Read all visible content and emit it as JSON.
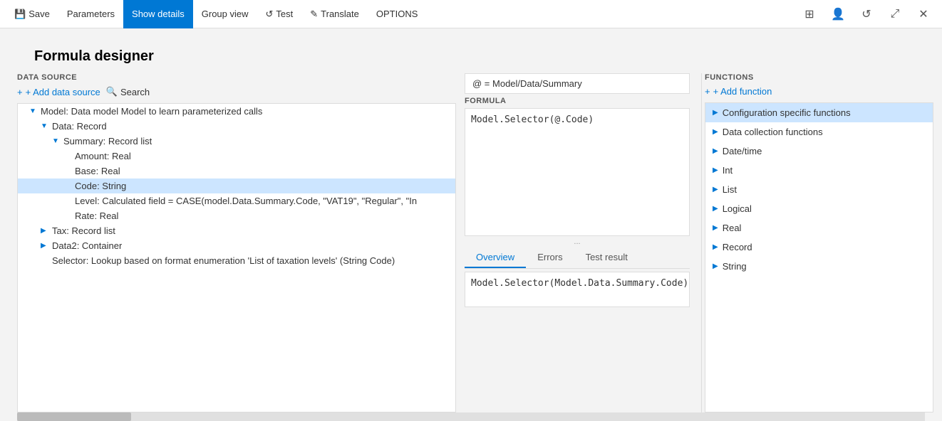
{
  "titlebar": {
    "save_label": "Save",
    "parameters_label": "Parameters",
    "show_details_label": "Show details",
    "group_view_label": "Group view",
    "test_label": "Test",
    "translate_label": "Translate",
    "options_label": "OPTIONS"
  },
  "page": {
    "title": "Formula designer"
  },
  "datasource": {
    "label": "DATA SOURCE",
    "add_label": "+ Add data source",
    "search_label": "Search",
    "tree": [
      {
        "level": 1,
        "indent": "indent-1",
        "has_arrow": true,
        "arrow": "▼",
        "text": "Model: Data model Model to learn parameterized calls",
        "selected": false
      },
      {
        "level": 2,
        "indent": "indent-2",
        "has_arrow": true,
        "arrow": "▼",
        "text": "Data: Record",
        "selected": false
      },
      {
        "level": 3,
        "indent": "indent-3",
        "has_arrow": true,
        "arrow": "▼",
        "text": "Summary: Record list",
        "selected": false
      },
      {
        "level": 4,
        "indent": "indent-4",
        "has_arrow": false,
        "arrow": "",
        "text": "Amount: Real",
        "selected": false
      },
      {
        "level": 4,
        "indent": "indent-4",
        "has_arrow": false,
        "arrow": "",
        "text": "Base: Real",
        "selected": false
      },
      {
        "level": 4,
        "indent": "indent-4",
        "has_arrow": false,
        "arrow": "",
        "text": "Code: String",
        "selected": true
      },
      {
        "level": 4,
        "indent": "indent-4",
        "has_arrow": false,
        "arrow": "",
        "text": "Level: Calculated field = CASE(model.Data.Summary.Code, \"VAT19\", \"Regular\", \"In",
        "selected": false
      },
      {
        "level": 4,
        "indent": "indent-4",
        "has_arrow": false,
        "arrow": "",
        "text": "Rate: Real",
        "selected": false
      },
      {
        "level": 2,
        "indent": "indent-2",
        "has_arrow": true,
        "arrow": "▶",
        "text": "Tax: Record list",
        "selected": false
      },
      {
        "level": 2,
        "indent": "indent-2",
        "has_arrow": true,
        "arrow": "▶",
        "text": "Data2: Container",
        "selected": false
      },
      {
        "level": 2,
        "indent": "indent-2",
        "has_arrow": false,
        "arrow": "",
        "text": "Selector: Lookup based on format enumeration 'List of taxation levels' (String Code)",
        "selected": false
      }
    ]
  },
  "formula": {
    "path": "@ = Model/Data/Summary",
    "label": "FORMULA",
    "expression": "Model.Selector(@.Code)",
    "more_indicator": "...",
    "tabs": [
      {
        "id": "overview",
        "label": "Overview",
        "active": true
      },
      {
        "id": "errors",
        "label": "Errors",
        "active": false
      },
      {
        "id": "test_result",
        "label": "Test result",
        "active": false
      }
    ],
    "result": "Model.Selector(Model.Data.Summary.Code)"
  },
  "functions": {
    "label": "FUNCTIONS",
    "add_label": "+ Add function",
    "items": [
      {
        "label": "Configuration specific functions",
        "selected": true
      },
      {
        "label": "Data collection functions",
        "selected": false
      },
      {
        "label": "Date/time",
        "selected": false
      },
      {
        "label": "Int",
        "selected": false
      },
      {
        "label": "List",
        "selected": false
      },
      {
        "label": "Logical",
        "selected": false
      },
      {
        "label": "Real",
        "selected": false
      },
      {
        "label": "Record",
        "selected": false
      },
      {
        "label": "String",
        "selected": false
      }
    ]
  },
  "icons": {
    "save": "💾",
    "search": "🔍",
    "test": "↺",
    "translate": "✎",
    "plus": "+",
    "arrow_right": "▶",
    "arrow_down": "▼",
    "gear": "⚙",
    "person": "👤",
    "refresh": "↺",
    "expand": "⤢",
    "close": "✕"
  }
}
